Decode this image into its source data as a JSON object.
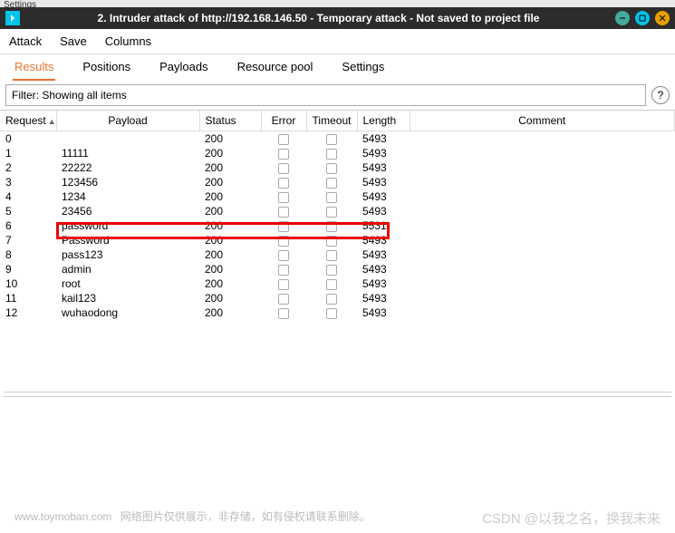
{
  "truncated_label": "Settings",
  "window": {
    "title": "2.  Intruder attack of http://192.168.146.50 - Temporary attack - Not saved to project file"
  },
  "menu": {
    "attack": "Attack",
    "save": "Save",
    "columns": "Columns"
  },
  "tabs": {
    "results": "Results",
    "positions": "Positions",
    "payloads": "Payloads",
    "resource_pool": "Resource pool",
    "settings": "Settings"
  },
  "filter": {
    "text": "Filter: Showing all items",
    "help": "?"
  },
  "columns": {
    "request": "Request",
    "payload": "Payload",
    "status": "Status",
    "error": "Error",
    "timeout": "Timeout",
    "length": "Length",
    "comment": "Comment"
  },
  "rows": [
    {
      "req": "0",
      "payload": "",
      "status": "200",
      "length": "5493"
    },
    {
      "req": "1",
      "payload": "11111",
      "status": "200",
      "length": "5493"
    },
    {
      "req": "2",
      "payload": "22222",
      "status": "200",
      "length": "5493"
    },
    {
      "req": "3",
      "payload": "123456",
      "status": "200",
      "length": "5493"
    },
    {
      "req": "4",
      "payload": "1234",
      "status": "200",
      "length": "5493"
    },
    {
      "req": "5",
      "payload": "23456",
      "status": "200",
      "length": "5493"
    },
    {
      "req": "6",
      "payload": "password",
      "status": "200",
      "length": "5531",
      "highlight": true
    },
    {
      "req": "7",
      "payload": "Password",
      "status": "200",
      "length": "5493"
    },
    {
      "req": "8",
      "payload": "pass123",
      "status": "200",
      "length": "5493"
    },
    {
      "req": "9",
      "payload": "admin",
      "status": "200",
      "length": "5493"
    },
    {
      "req": "10",
      "payload": "root",
      "status": "200",
      "length": "5493"
    },
    {
      "req": "11",
      "payload": "kail123",
      "status": "200",
      "length": "5493"
    },
    {
      "req": "12",
      "payload": "wuhaodong",
      "status": "200",
      "length": "5493"
    }
  ],
  "watermark": {
    "left_a": "www.toymoban.com",
    "left_b": "网络图片仅供展示，非存储，如有侵权请联系删除。",
    "right": "CSDN @以我之名，换我未来"
  }
}
